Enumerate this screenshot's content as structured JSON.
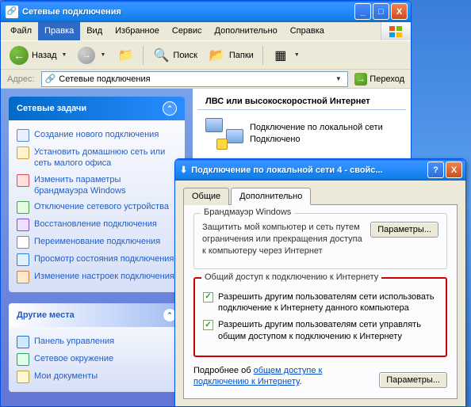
{
  "window": {
    "title": "Сетевые подключения",
    "controls": {
      "min": "_",
      "max": "□",
      "close": "X"
    }
  },
  "menubar": {
    "items": [
      "Файл",
      "Правка",
      "Вид",
      "Избранное",
      "Сервис",
      "Дополнительно",
      "Справка"
    ],
    "active_index": 1
  },
  "toolbar": {
    "back": "Назад",
    "search": "Поиск",
    "folders": "Папки"
  },
  "addressbar": {
    "label": "Адрес:",
    "value": "Сетевые подключения",
    "go": "Переход"
  },
  "sidebar": {
    "panel1": {
      "title": "Сетевые задачи",
      "links": [
        "Создание нового подключения",
        "Установить домашнюю сеть или сеть малого офиса",
        "Изменить параметры брандмауэра Windows",
        "Отключение сетевого устройства",
        "Восстановление подключения",
        "Переименование подключения",
        "Просмотр состояния подключения",
        "Изменение настроек подключения"
      ]
    },
    "panel2": {
      "title": "Другие места",
      "links": [
        "Панель управления",
        "Сетевое окружение",
        "Мои документы"
      ]
    }
  },
  "main": {
    "group": "ЛВС или высокоскоростной Интернет",
    "conn_name": "Подключение по локальной сети",
    "conn_status": "Подключено"
  },
  "dialog": {
    "title": "Подключение по локальной сети 4 - свойс...",
    "help": "?",
    "close": "X",
    "tabs": [
      "Общие",
      "Дополнительно"
    ],
    "active_tab": 1,
    "firewall": {
      "legend": "Брандмауэр Windows",
      "text": "Защитить мой компьютер и сеть путем ограничения или прекращения доступа к компьютеру через Интернет",
      "button": "Параметры..."
    },
    "sharing": {
      "legend": "Общий доступ к подключению к Интернету",
      "check1": "Разрешить другим пользователям сети использовать подключение к Интернету данного компьютера",
      "check2": "Разрешить другим пользователям сети управлять общим доступом к подключению к Интернету"
    },
    "footer": {
      "text_before": "Подробнее об ",
      "link": "общем доступе к подключению к Интернету",
      "text_after": ".",
      "button": "Параметры..."
    }
  }
}
